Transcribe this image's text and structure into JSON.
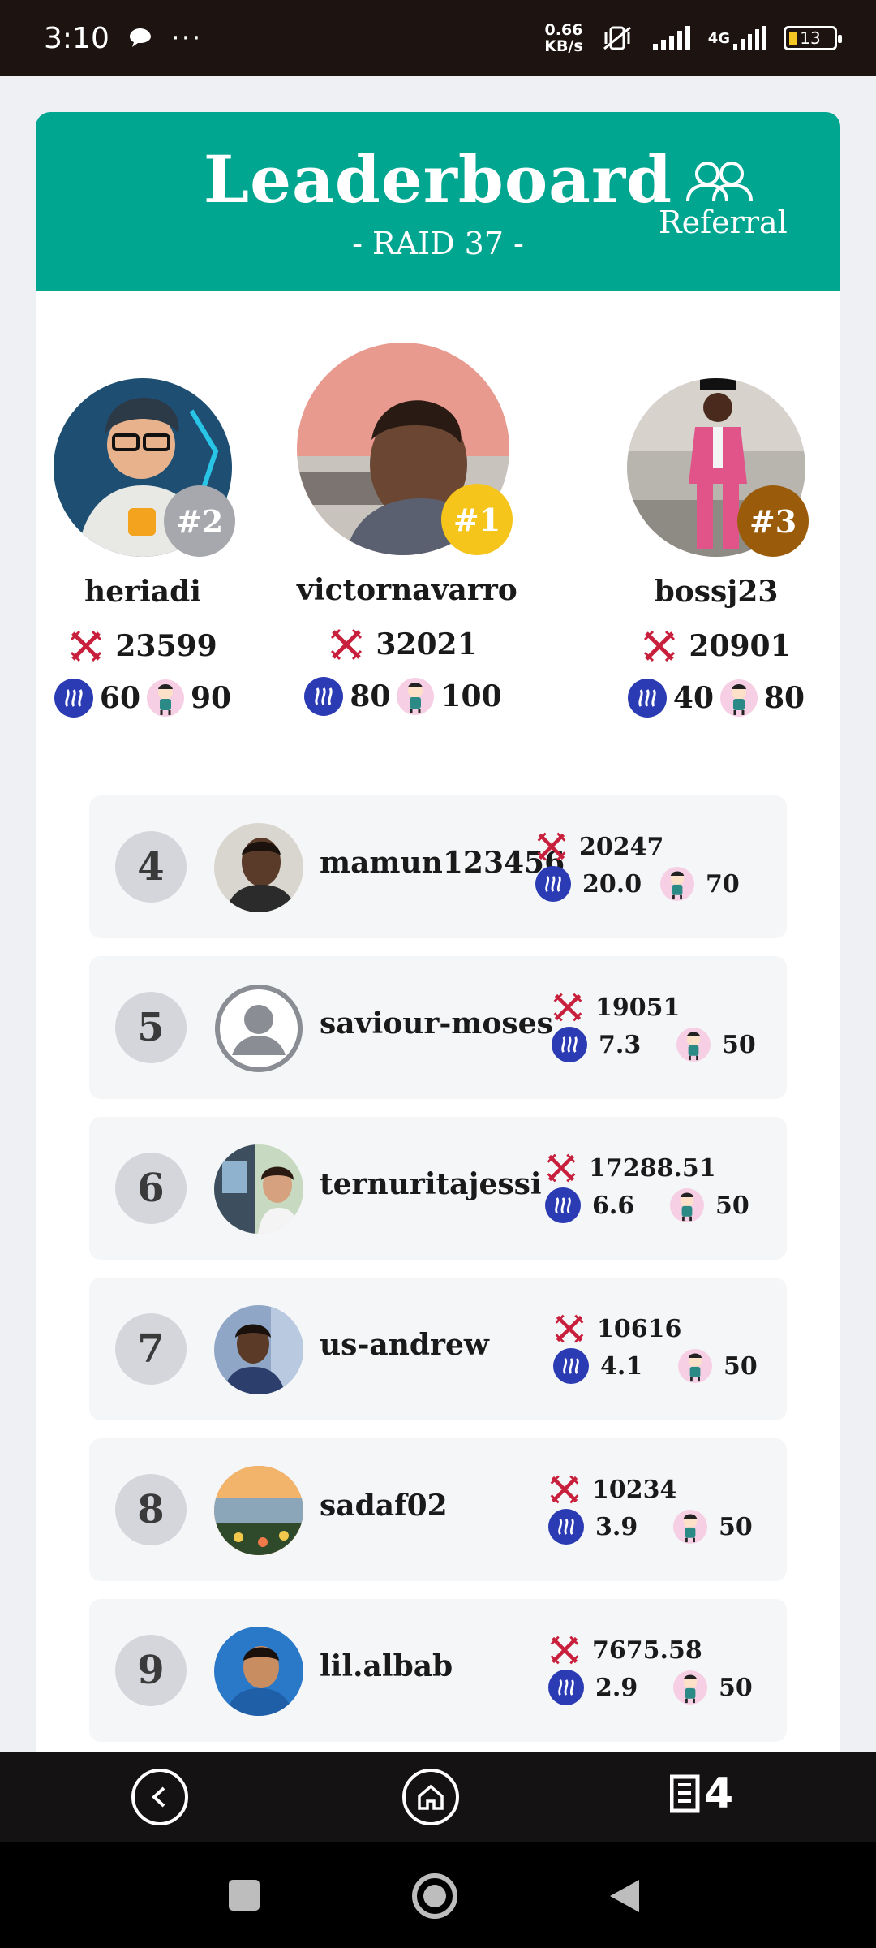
{
  "status_bar": {
    "time": "3:10",
    "speed_value": "0.66",
    "speed_unit": "KB/s",
    "network": "4G",
    "battery": "13"
  },
  "header": {
    "title": "Leaderboard",
    "subtitle": "- RAID 37 -",
    "referral_label": "Referral"
  },
  "podium": [
    {
      "rank": "#2",
      "username": "heriadi",
      "score": "23599",
      "steem": "60",
      "sticker": "90",
      "badge_color": "#a6a8ad"
    },
    {
      "rank": "#1",
      "username": "victornavarro",
      "score": "32021",
      "steem": "80",
      "sticker": "100",
      "badge_color": "#f5c51b"
    },
    {
      "rank": "#3",
      "username": "bossj23",
      "score": "20901",
      "steem": "40",
      "sticker": "80",
      "badge_color": "#9a5b0a"
    }
  ],
  "rows": [
    {
      "rank": "4",
      "username": "mamun123456",
      "score": "20247",
      "steem": "20.0",
      "sticker": "70"
    },
    {
      "rank": "5",
      "username": "saviour-moses",
      "score": "19051",
      "steem": "7.3",
      "sticker": "50"
    },
    {
      "rank": "6",
      "username": "ternuritajessi",
      "score": "17288.51",
      "steem": "6.6",
      "sticker": "50"
    },
    {
      "rank": "7",
      "username": "us-andrew",
      "score": "10616",
      "steem": "4.1",
      "sticker": "50"
    },
    {
      "rank": "8",
      "username": "sadaf02",
      "score": "10234",
      "steem": "3.9",
      "sticker": "50"
    },
    {
      "rank": "9",
      "username": "lil.albab",
      "score": "7675.58",
      "steem": "2.9",
      "sticker": "50"
    }
  ],
  "bottom_nav": {
    "tab_count": "4"
  },
  "icons": {
    "score": "crossed-swords-icon",
    "steem": "steem-coin-icon",
    "sticker": "character-sticker-icon"
  }
}
